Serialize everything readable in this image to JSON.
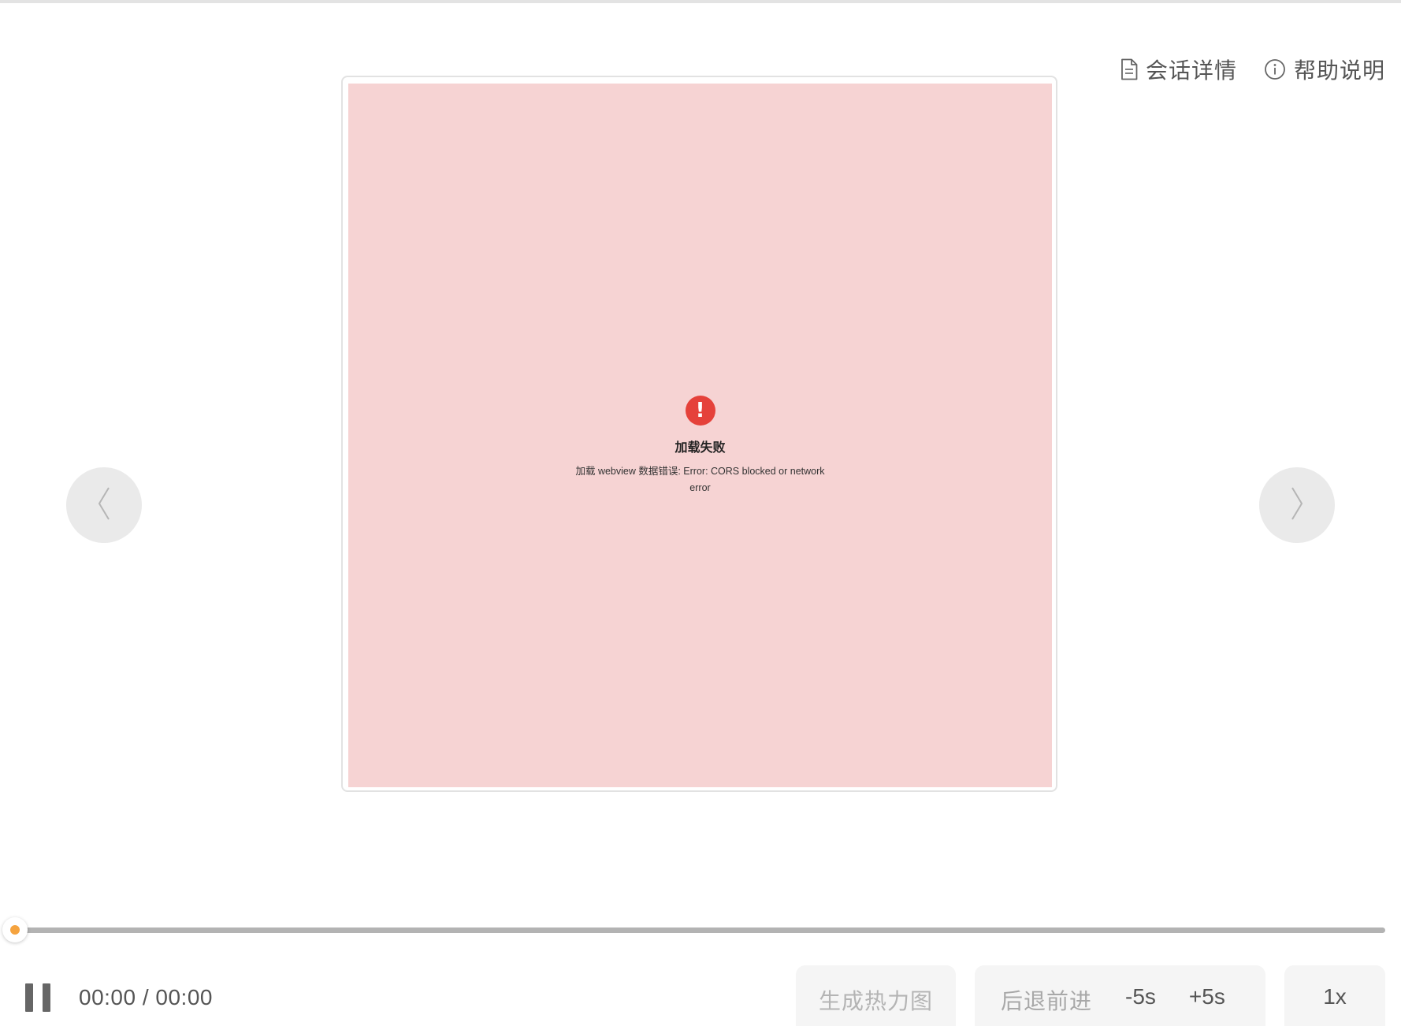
{
  "header": {
    "session_details_label": "会话详情",
    "help_label": "帮助说明"
  },
  "viewer": {
    "error_title": "加载失败",
    "error_message": "加载 webview 数据错误: Error: CORS blocked or network error",
    "error_icon_glyph": "!",
    "background_color": "#f6d3d3",
    "error_color": "#e5413a"
  },
  "timeline": {
    "progress": 0,
    "knob_color": "#f5a33f"
  },
  "controls": {
    "time_display": "00:00 / 00:00",
    "heatmap_label": "生成热力图",
    "seek_label": "后退前进",
    "rewind_label": "-5s",
    "forward_label": "+5s",
    "speed_label": "1x"
  }
}
